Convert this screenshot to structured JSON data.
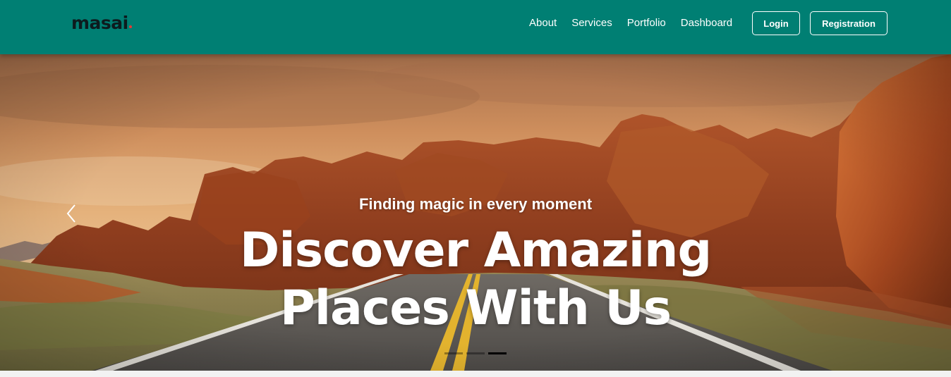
{
  "brand": {
    "logo_text": "masai"
  },
  "nav": {
    "links": [
      "About",
      "Services",
      "Portfolio",
      "Dashboard"
    ],
    "login_label": "Login",
    "register_label": "Registration"
  },
  "hero": {
    "subtitle": "Finding magic in every moment",
    "title_line1": "Discover Amazing",
    "title_line2": "Places With Us",
    "slides_count": 3,
    "active_slide": 3
  },
  "colors": {
    "navbar": "#007f73",
    "logo_accent": "#e53935",
    "text": "#ffffff"
  },
  "icons": {
    "prev": "chevron-left-icon"
  }
}
